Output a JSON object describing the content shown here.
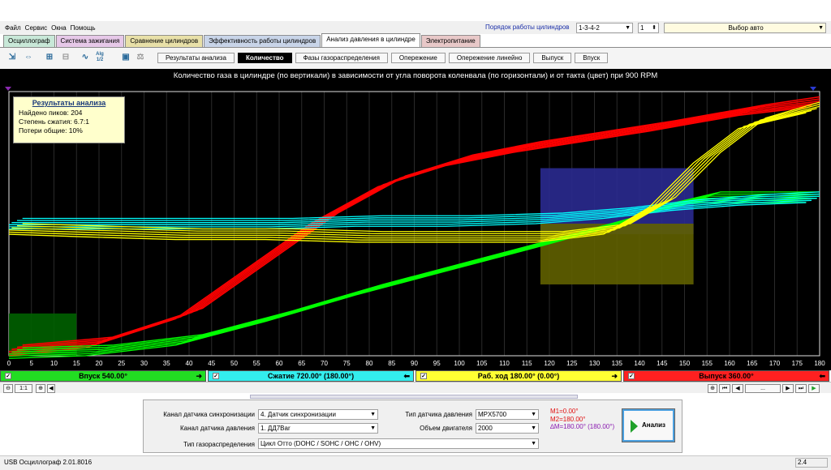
{
  "menu": [
    "Файл",
    "Сервис",
    "Окна",
    "Помощь"
  ],
  "cylinder_order": {
    "label": "Порядок работы цилиндров",
    "value": "1-3-4-2",
    "count": "1"
  },
  "car_select": "Выбор авто",
  "tabs": [
    {
      "label": "Осциллограф",
      "color": "#c8e8d8"
    },
    {
      "label": "Система зажигания",
      "color": "#e6c8e8"
    },
    {
      "label": "Сравнение цилиндров",
      "color": "#e8e0a8"
    },
    {
      "label": "Эффективность работы цилиндров",
      "color": "#c8d4e8"
    },
    {
      "label": "Анализ давления в цилиндре",
      "color": "#ffffff",
      "active": true
    },
    {
      "label": "Электропитание",
      "color": "#e8c8c8"
    }
  ],
  "toolbar": {
    "icons": [
      "fit-icon",
      "zoom-icon",
      "cursor-icon",
      "autoscale-icon",
      "grid-icon",
      "trend-icon",
      "algorithm-icon",
      "save-icon",
      "scale-icon"
    ],
    "alg_label": "Alg 1/2"
  },
  "subtabs": [
    "Результаты анализа",
    "Количество",
    "Фазы газораспределения",
    "Опережение",
    "Опережение линейно",
    "Выпуск",
    "Впуск"
  ],
  "active_subtab": 1,
  "chart_title": "Количество газа в цилиндре (по вертикали) в зависимости от угла поворота коленвала (по горизонтали) и от такта (цвет) при 900 RPM",
  "results": {
    "title": "Результаты анализа",
    "lines": [
      "Найдено пиков: 204",
      "Степень сжатия: 6.7:1",
      "Потери общие: 10%"
    ]
  },
  "chart_data": {
    "type": "line",
    "title": "Количество газа в цилиндре (по вертикали) в зависимости от угла поворота коленвала (по горизонтали) и от такта (цвет) при 900 RPM",
    "xlabel": "",
    "ylabel": "",
    "xlim": [
      0,
      180
    ],
    "ylim": [
      0,
      1
    ],
    "x_ticks": [
      0,
      5,
      10,
      15,
      20,
      25,
      30,
      35,
      40,
      45,
      50,
      55,
      60,
      65,
      70,
      75,
      80,
      85,
      90,
      95,
      100,
      105,
      110,
      115,
      120,
      125,
      130,
      135,
      140,
      145,
      150,
      155,
      160,
      165,
      170,
      175,
      180
    ],
    "series": [
      {
        "color": "#ff0000",
        "values": [
          [
            0,
            0.02
          ],
          [
            20,
            0.05
          ],
          [
            40,
            0.16
          ],
          [
            55,
            0.34
          ],
          [
            70,
            0.52
          ],
          [
            85,
            0.66
          ],
          [
            100,
            0.74
          ],
          [
            115,
            0.79
          ],
          [
            130,
            0.83
          ],
          [
            145,
            0.87
          ],
          [
            155,
            0.9
          ],
          [
            165,
            0.93
          ],
          [
            180,
            0.96
          ]
        ]
      },
      {
        "color": "#00ff00",
        "values": [
          [
            0,
            0.01
          ],
          [
            20,
            0.02
          ],
          [
            40,
            0.06
          ],
          [
            60,
            0.15
          ],
          [
            80,
            0.25
          ],
          [
            100,
            0.34
          ],
          [
            120,
            0.43
          ],
          [
            135,
            0.5
          ],
          [
            145,
            0.56
          ],
          [
            155,
            0.6
          ],
          [
            165,
            0.6
          ],
          [
            180,
            0.6
          ]
        ]
      },
      {
        "color": "#00ffff",
        "values": [
          [
            0,
            0.5
          ],
          [
            20,
            0.5
          ],
          [
            40,
            0.5
          ],
          [
            60,
            0.5
          ],
          [
            80,
            0.51
          ],
          [
            100,
            0.51
          ],
          [
            120,
            0.52
          ],
          [
            135,
            0.54
          ],
          [
            150,
            0.57
          ],
          [
            165,
            0.59
          ],
          [
            180,
            0.6
          ]
        ]
      },
      {
        "color": "#ffff00",
        "values": [
          [
            0,
            0.48
          ],
          [
            20,
            0.47
          ],
          [
            40,
            0.46
          ],
          [
            60,
            0.46
          ],
          [
            80,
            0.45
          ],
          [
            100,
            0.45
          ],
          [
            120,
            0.45
          ],
          [
            135,
            0.48
          ],
          [
            145,
            0.58
          ],
          [
            155,
            0.75
          ],
          [
            165,
            0.88
          ],
          [
            180,
            0.94
          ]
        ]
      }
    ],
    "regions": [
      {
        "color": "#2a2a90",
        "x": [
          118,
          152
        ],
        "y": [
          0.46,
          0.71
        ]
      },
      {
        "color": "#606000",
        "x": [
          118,
          152
        ],
        "y": [
          0.27,
          0.5
        ]
      },
      {
        "color": "#006000",
        "x": [
          0,
          15
        ],
        "y": [
          0,
          0.16
        ]
      }
    ]
  },
  "strokes": [
    {
      "label": "Впуск 540.00°",
      "color": "#22dd22"
    },
    {
      "label": "Сжатие 720.00° (180.00°)",
      "color": "#33eeee"
    },
    {
      "label": "Раб. ход 180.00° (0.00°)",
      "color": "#ffff33"
    },
    {
      "label": "Выпуск 360.00°",
      "color": "#ff2020"
    }
  ],
  "zoom": {
    "ratio": "1:1",
    "nav_dots": "..."
  },
  "settings": {
    "sync_channel": {
      "label": "Канал датчика синхронизации",
      "value": "4. Датчик синхронизации"
    },
    "pressure_channel": {
      "label": "Канал датчика давления",
      "value": "1. ДД7Bar"
    },
    "timing_type": {
      "label": "Тип газораспределения",
      "value": "Цикл Отто (DOHC / SOHC / OHC / OHV)"
    },
    "pressure_sensor_type": {
      "label": "Тип датчика давления",
      "value": "MPX5700"
    },
    "engine_volume": {
      "label": "Объем двигателя",
      "value": "2000"
    }
  },
  "markers": {
    "m1": "M1=0.00°",
    "m2": "M2=180.00°",
    "delta": "∆M=180.00° (180.00°)",
    "m1_color": "#e01010",
    "m2_color": "#e01010",
    "delta_color": "#8a1ab0"
  },
  "analyze_button": "Анализ",
  "status": {
    "left": "USB Осциллограф  2.01.8016",
    "right": "2.4"
  }
}
